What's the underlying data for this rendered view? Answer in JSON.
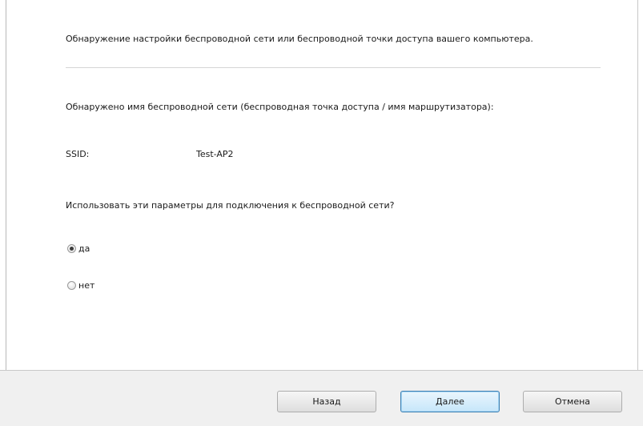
{
  "main": {
    "header_text": "Обнаружение настройки беспроводной сети или беспроводной точки доступа вашего компьютера.",
    "detected_label": "Обнаружено имя беспроводной сети (беспроводная точка доступа / имя маршрутизатора):",
    "ssid_label": "SSID:",
    "ssid_value": "Test-AP2",
    "question": "Использовать эти параметры для подключения к беспроводной сети?",
    "options": [
      {
        "label": "да",
        "selected": true
      },
      {
        "label": "нет",
        "selected": false
      }
    ]
  },
  "footer": {
    "back_label": "Назад",
    "next_label": "Далее",
    "cancel_label": "Отмена"
  }
}
